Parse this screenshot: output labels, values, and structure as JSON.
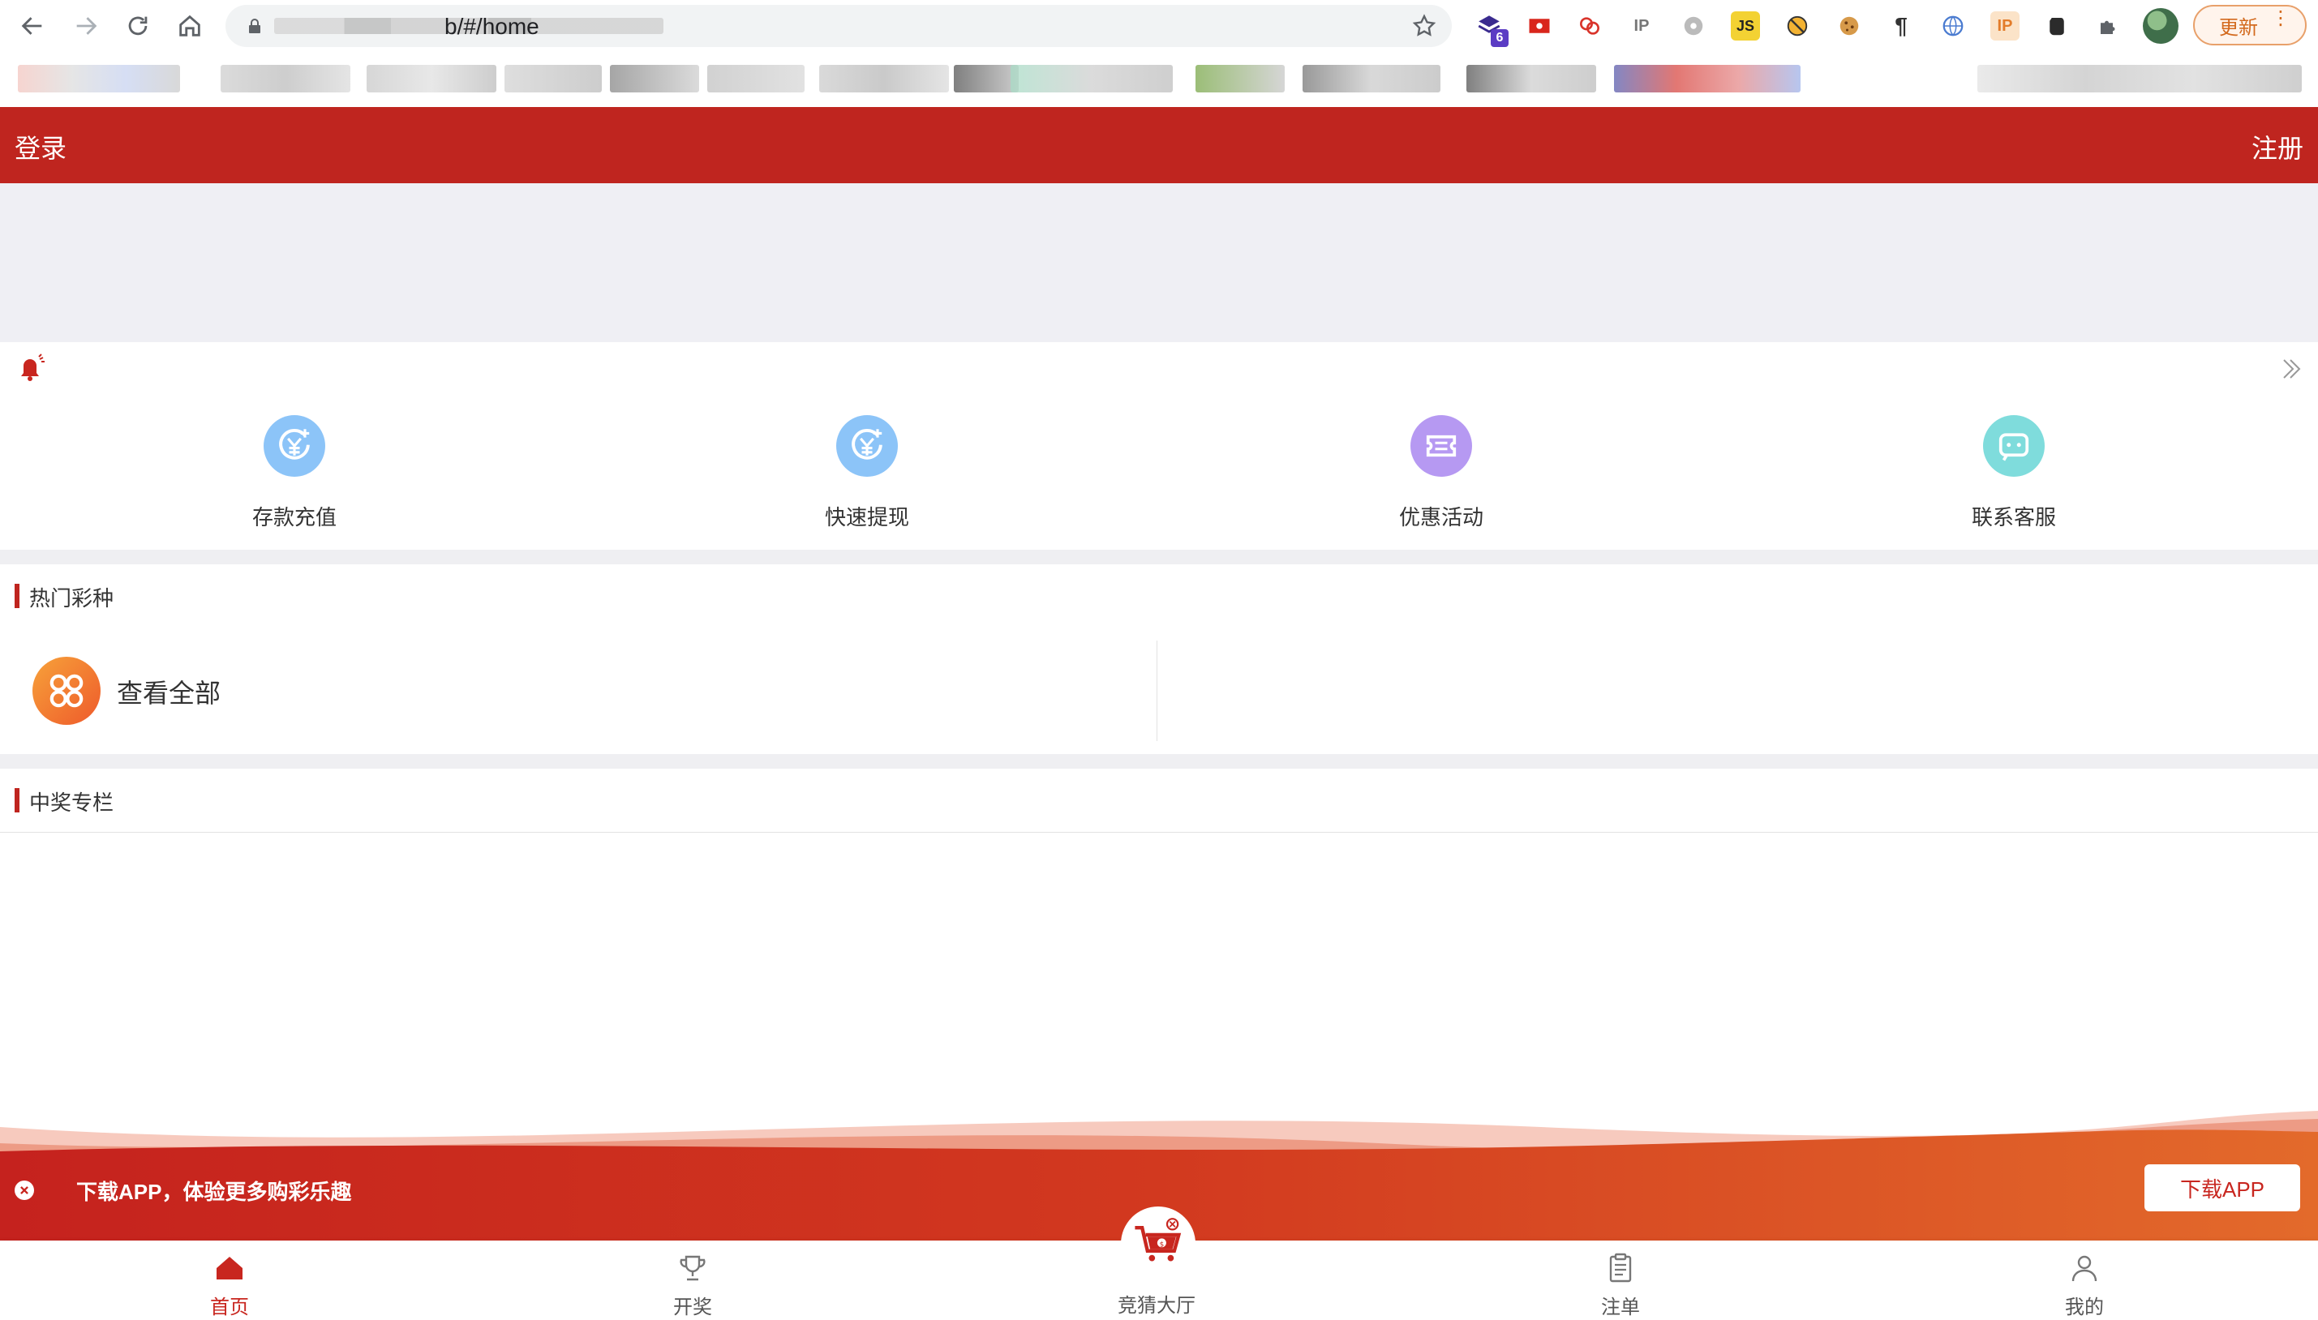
{
  "browser": {
    "url_visible_suffix": "b/#/home",
    "update_button_label": "更新",
    "extension_badge_count": "6",
    "extensions": [
      "stack-extension-icon",
      "flag-extension-icon",
      "link-extension-icon",
      "ip-lookup-extension-icon",
      "gear-extension-icon",
      "js-extension-icon",
      "block-extension-icon",
      "cookie-extension-icon",
      "paragraph-extension-icon",
      "globe-extension-icon",
      "ip-extension-icon",
      "evernote-extension-icon",
      "puzzle-extension-icon"
    ]
  },
  "header": {
    "login_label": "登录",
    "register_label": "注册"
  },
  "quick_actions": [
    {
      "label": "存款充值",
      "icon": "yuan-refresh-icon",
      "color": "#8cc4f8"
    },
    {
      "label": "快速提现",
      "icon": "yuan-refresh-icon",
      "color": "#8cc4f8"
    },
    {
      "label": "优惠活动",
      "icon": "ticket-icon",
      "color": "#b699f2"
    },
    {
      "label": "联系客服",
      "icon": "chat-icon",
      "color": "#7fdcdc"
    }
  ],
  "hot_lottery": {
    "title": "热门彩种",
    "view_all_label": "查看全部"
  },
  "winning_column": {
    "title": "中奖专栏"
  },
  "promo": {
    "text": "下载APP，体验更多购彩乐趣",
    "button_label": "下载APP"
  },
  "tabbar": [
    {
      "label": "首页",
      "icon": "home-icon",
      "active": true
    },
    {
      "label": "开奖",
      "icon": "trophy-icon",
      "active": false
    },
    {
      "label": "竞猜大厅",
      "icon": "cart-icon",
      "active": false
    },
    {
      "label": "注单",
      "icon": "clipboard-icon",
      "active": false
    },
    {
      "label": "我的",
      "icon": "user-icon",
      "active": false
    }
  ],
  "colors": {
    "brand_red": "#bf251f",
    "banner_gray": "#efeff4",
    "promo_orange": "#e3652b"
  }
}
